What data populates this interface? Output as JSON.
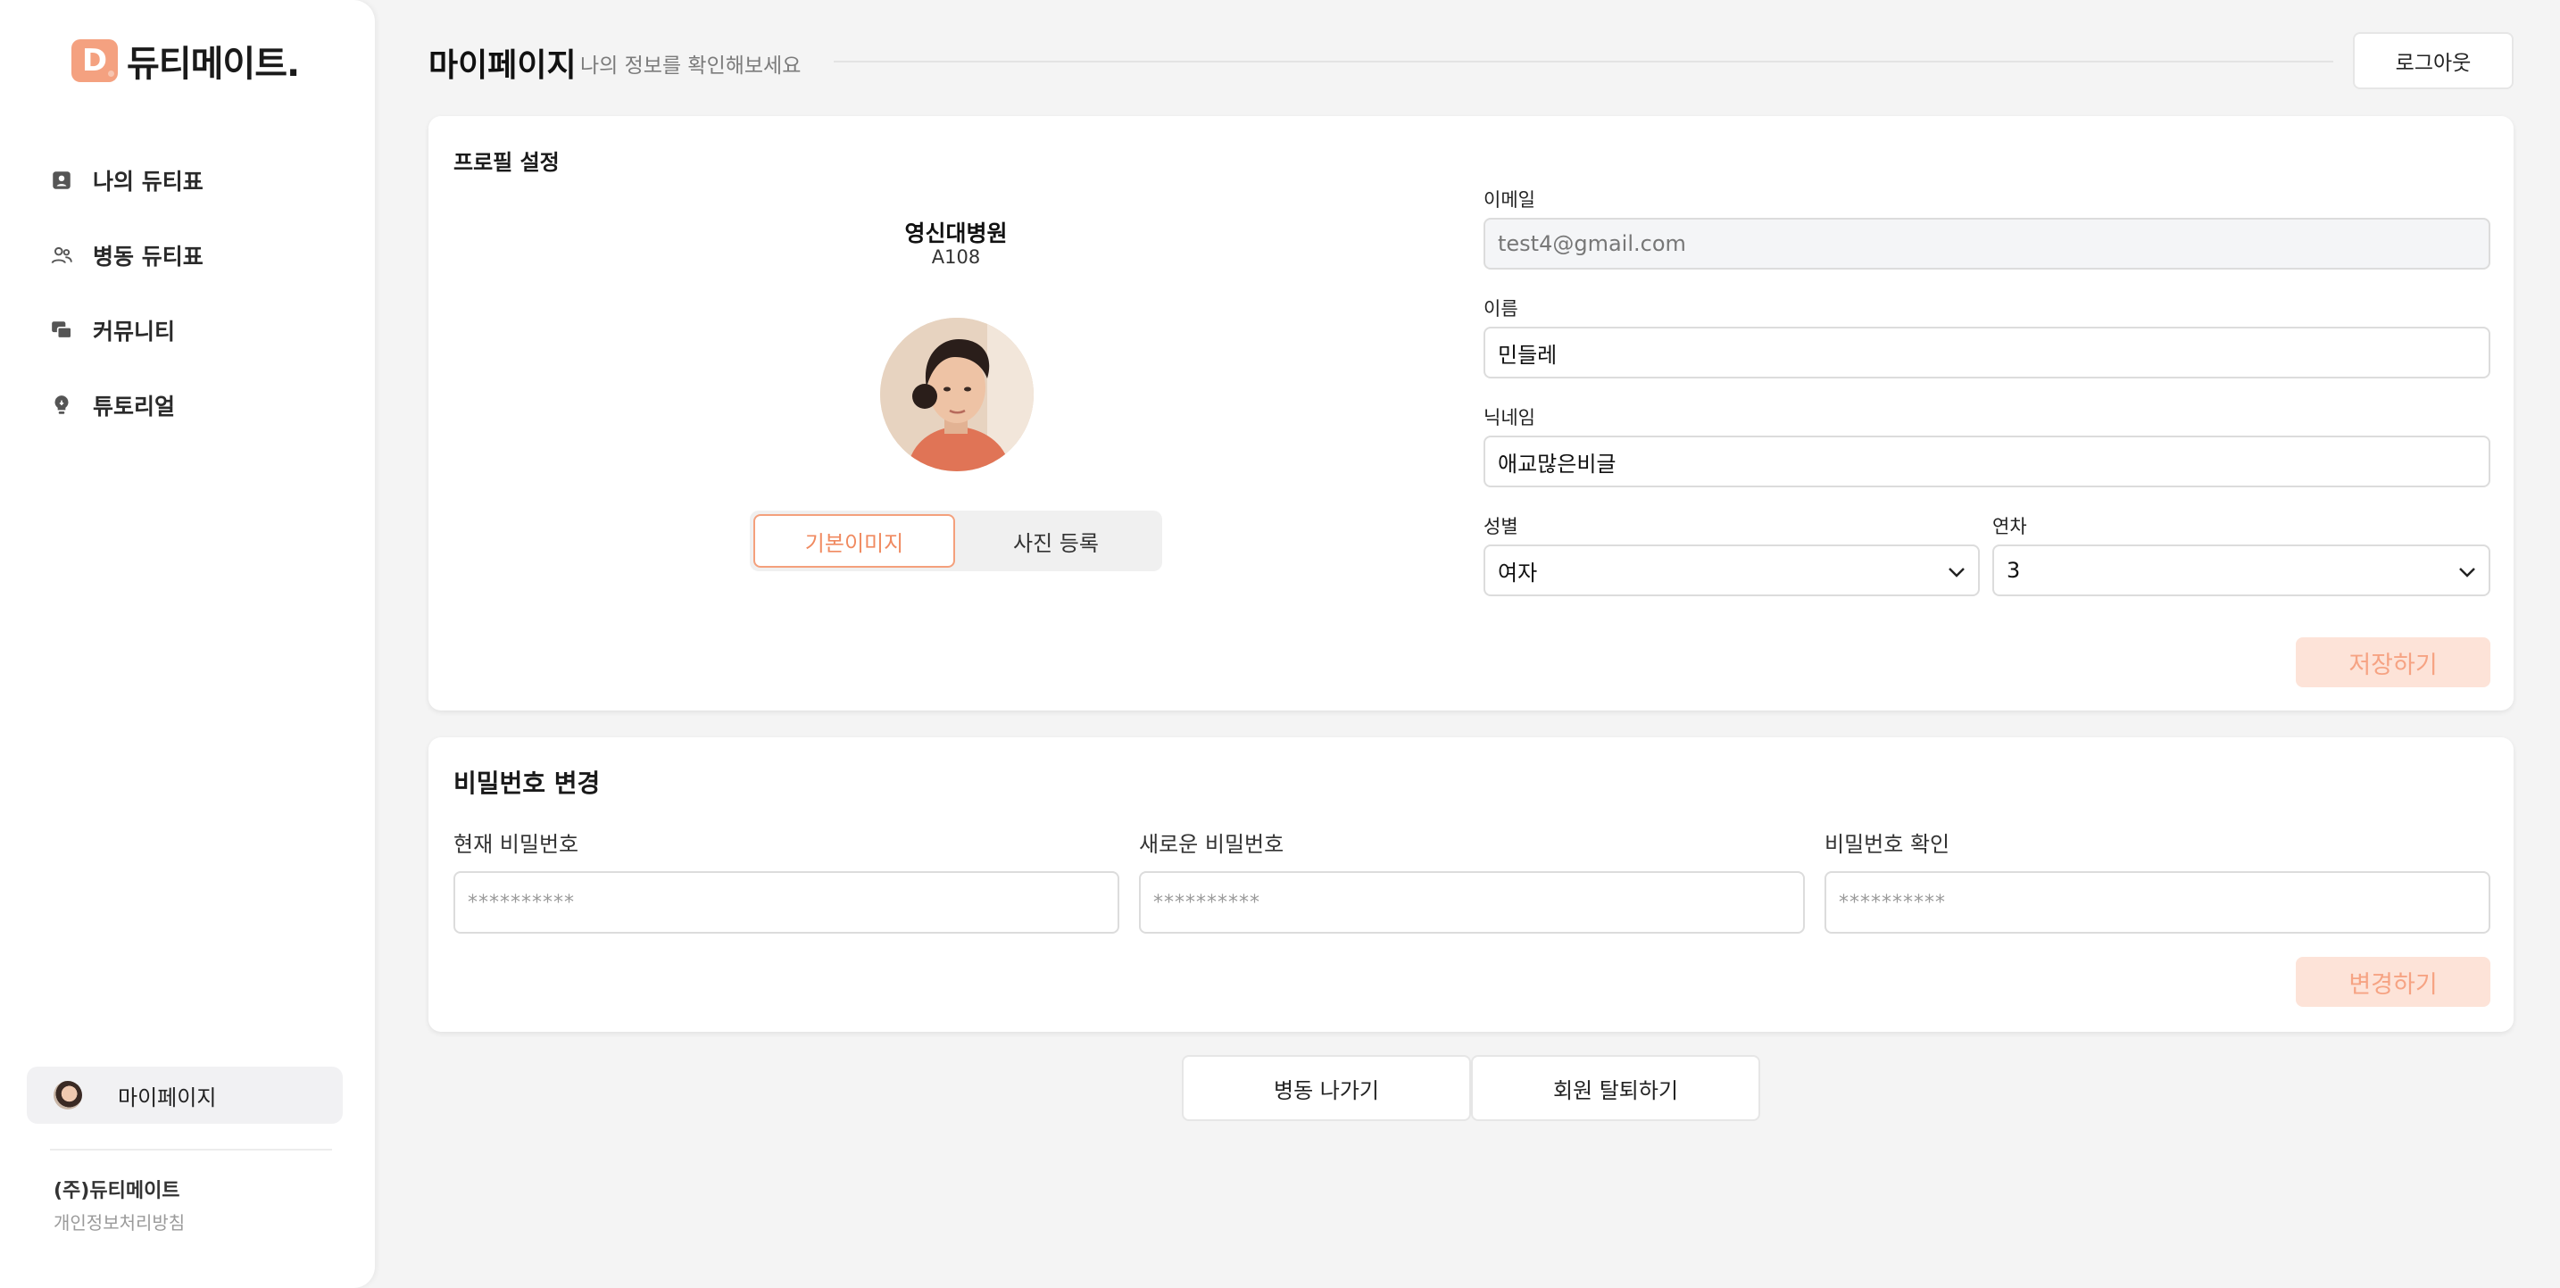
{
  "brand": {
    "logo_letter": "D",
    "name": "듀티메이트."
  },
  "sidebar": {
    "items": [
      {
        "label": "나의 듀티표",
        "icon": "person-card-icon"
      },
      {
        "label": "병동 듀티표",
        "icon": "users-icon"
      },
      {
        "label": "커뮤니티",
        "icon": "chat-icon"
      },
      {
        "label": "튜토리얼",
        "icon": "lightbulb-icon"
      }
    ],
    "mypage_label": "마이페이지",
    "company": "(주)듀티메이트",
    "privacy": "개인정보처리방침"
  },
  "header": {
    "title": "마이페이지",
    "subtitle": "나의 정보를 확인해보세요",
    "logout_label": "로그아웃"
  },
  "profile": {
    "section_title": "프로필 설정",
    "hospital_name": "영신대병원",
    "ward_code": "A108",
    "photo_default_label": "기본이미지",
    "photo_upload_label": "사진 등록",
    "email_label": "이메일",
    "email_value": "test4@gmail.com",
    "name_label": "이름",
    "name_value": "민들레",
    "nickname_label": "닉네임",
    "nickname_value": "애교많은비글",
    "gender_label": "성별",
    "gender_value": "여자",
    "year_label": "연차",
    "year_value": "3",
    "save_label": "저장하기"
  },
  "password": {
    "section_title": "비밀번호 변경",
    "current_label": "현재 비밀번호",
    "new_label": "새로운 비밀번호",
    "confirm_label": "비밀번호 확인",
    "placeholder": "**********",
    "change_label": "변경하기"
  },
  "actions": {
    "leave_ward_label": "병동 나가기",
    "withdraw_label": "회원 탈퇴하기"
  },
  "colors": {
    "accent": "#f4a180",
    "disabled_button_bg": "#fde3d8",
    "disabled_button_text": "#f6a383"
  }
}
